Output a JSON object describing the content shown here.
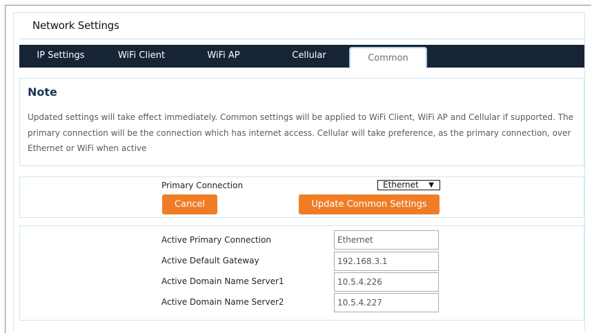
{
  "page": {
    "title": "Network Settings"
  },
  "tabs": [
    {
      "label": "IP Settings"
    },
    {
      "label": "WiFi Client"
    },
    {
      "label": "WiFi AP"
    },
    {
      "label": "Cellular"
    },
    {
      "label": "Common",
      "active": true
    }
  ],
  "note": {
    "title": "Note",
    "text": "Updated settings will take effect immediately. Common settings will be applied to WiFi Client, WiFi AP and Cellular if supported. The primary connection will be the connection which has internet access. Cellular will take preference, as the primary connection, over Ethernet or WiFi when active"
  },
  "primary": {
    "label": "Primary Connection",
    "selected": "Ethernet",
    "cancel_label": "Cancel",
    "update_label": "Update Common Settings"
  },
  "active": {
    "rows": [
      {
        "label": "Active Primary Connection",
        "value": "Ethernet"
      },
      {
        "label": "Active Default Gateway",
        "value": "192.168.3.1"
      },
      {
        "label": "Active Domain Name Server1",
        "value": "10.5.4.226"
      },
      {
        "label": "Active Domain Name Server2",
        "value": "10.5.4.227"
      }
    ]
  },
  "colors": {
    "accent": "#f07d26",
    "tabbar": "#162435",
    "border": "#cbe7f3"
  }
}
